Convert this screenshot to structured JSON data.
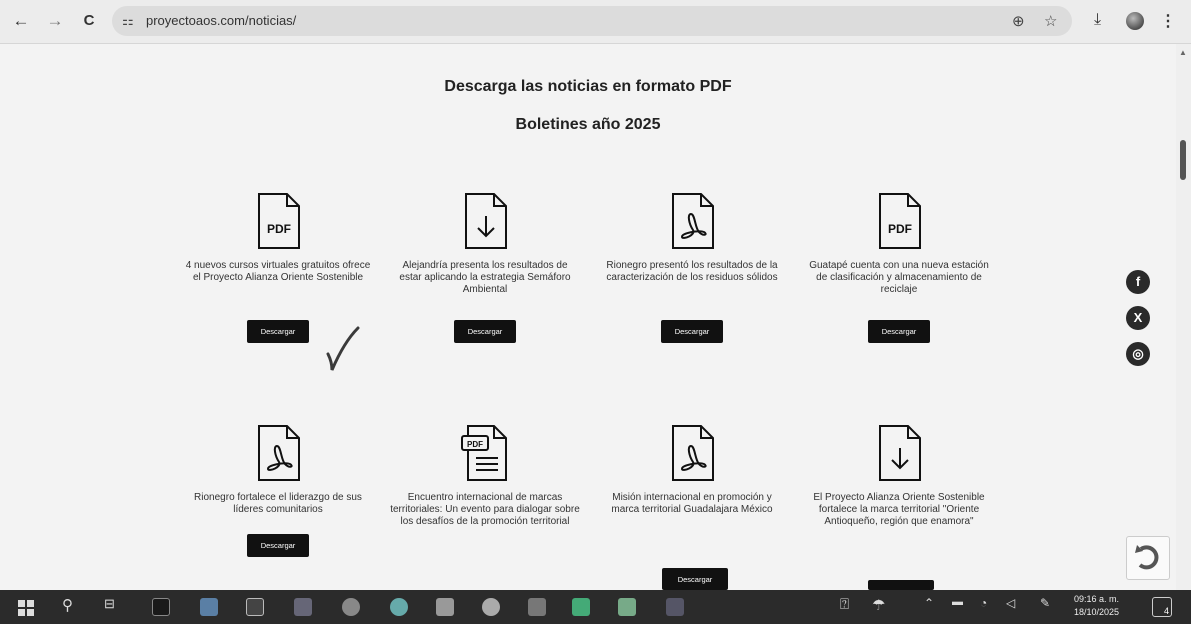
{
  "browser": {
    "url": "proyectoaos.com/noticias/",
    "back_icon": "←",
    "forward_icon": "→",
    "reload_icon": "C",
    "site_info_icon": "⚏",
    "zoom_icon": "⊕",
    "star_icon": "☆",
    "download_icon": "⤓",
    "menu_icon": "⋮"
  },
  "page": {
    "title": "Descarga las noticias en formato PDF",
    "subtitle": "Boletines año 2025",
    "cards": [
      {
        "icon": "pdf-text-icon",
        "text": "4 nuevos cursos virtuales gratuitos ofrece el Proyecto Alianza Oriente Sostenible",
        "button": "Descargar"
      },
      {
        "icon": "download-file-icon",
        "text": "Alejandría presenta los resultados de estar aplicando la estrategia Semáforo Ambiental",
        "button": "Descargar"
      },
      {
        "icon": "acrobat-file-icon",
        "text": "Rionegro presentó los resultados de la caracterización de los residuos sólidos",
        "button": "Descargar"
      },
      {
        "icon": "pdf-text-icon",
        "text": "Guatapé cuenta con una nueva estación de clasificación y almacenamiento de reciclaje",
        "button": "Descargar"
      },
      {
        "icon": "acrobat-file-icon",
        "text": "Rionegro fortalece el liderazgo de sus líderes comunitarios",
        "button": "Descargar"
      },
      {
        "icon": "pdf-document-icon",
        "text": "Encuentro internacional de marcas territoriales: Un evento para dialogar sobre los desafíos de la promoción territorial",
        "button": ""
      },
      {
        "icon": "acrobat-file-icon",
        "text": "Misión internacional en promoción y marca territorial Guadalajara México",
        "button": ""
      },
      {
        "icon": "download-file-icon",
        "text": "El Proyecto Alianza Oriente Sostenible fortalece la marca territorial \"Oriente Antioqueño, región que enamora\"",
        "button": ""
      }
    ],
    "floating_download": "Descargar",
    "pdf_label": "PDF",
    "social": {
      "facebook": "f",
      "x": "X",
      "instagram": "◎"
    }
  },
  "taskbar": {
    "time": "09:16 a. m.",
    "date": "18/10/2025",
    "notifications": "4"
  },
  "colors": {
    "button_bg": "#111111",
    "taskbar_bg": "#2b2b2b"
  }
}
